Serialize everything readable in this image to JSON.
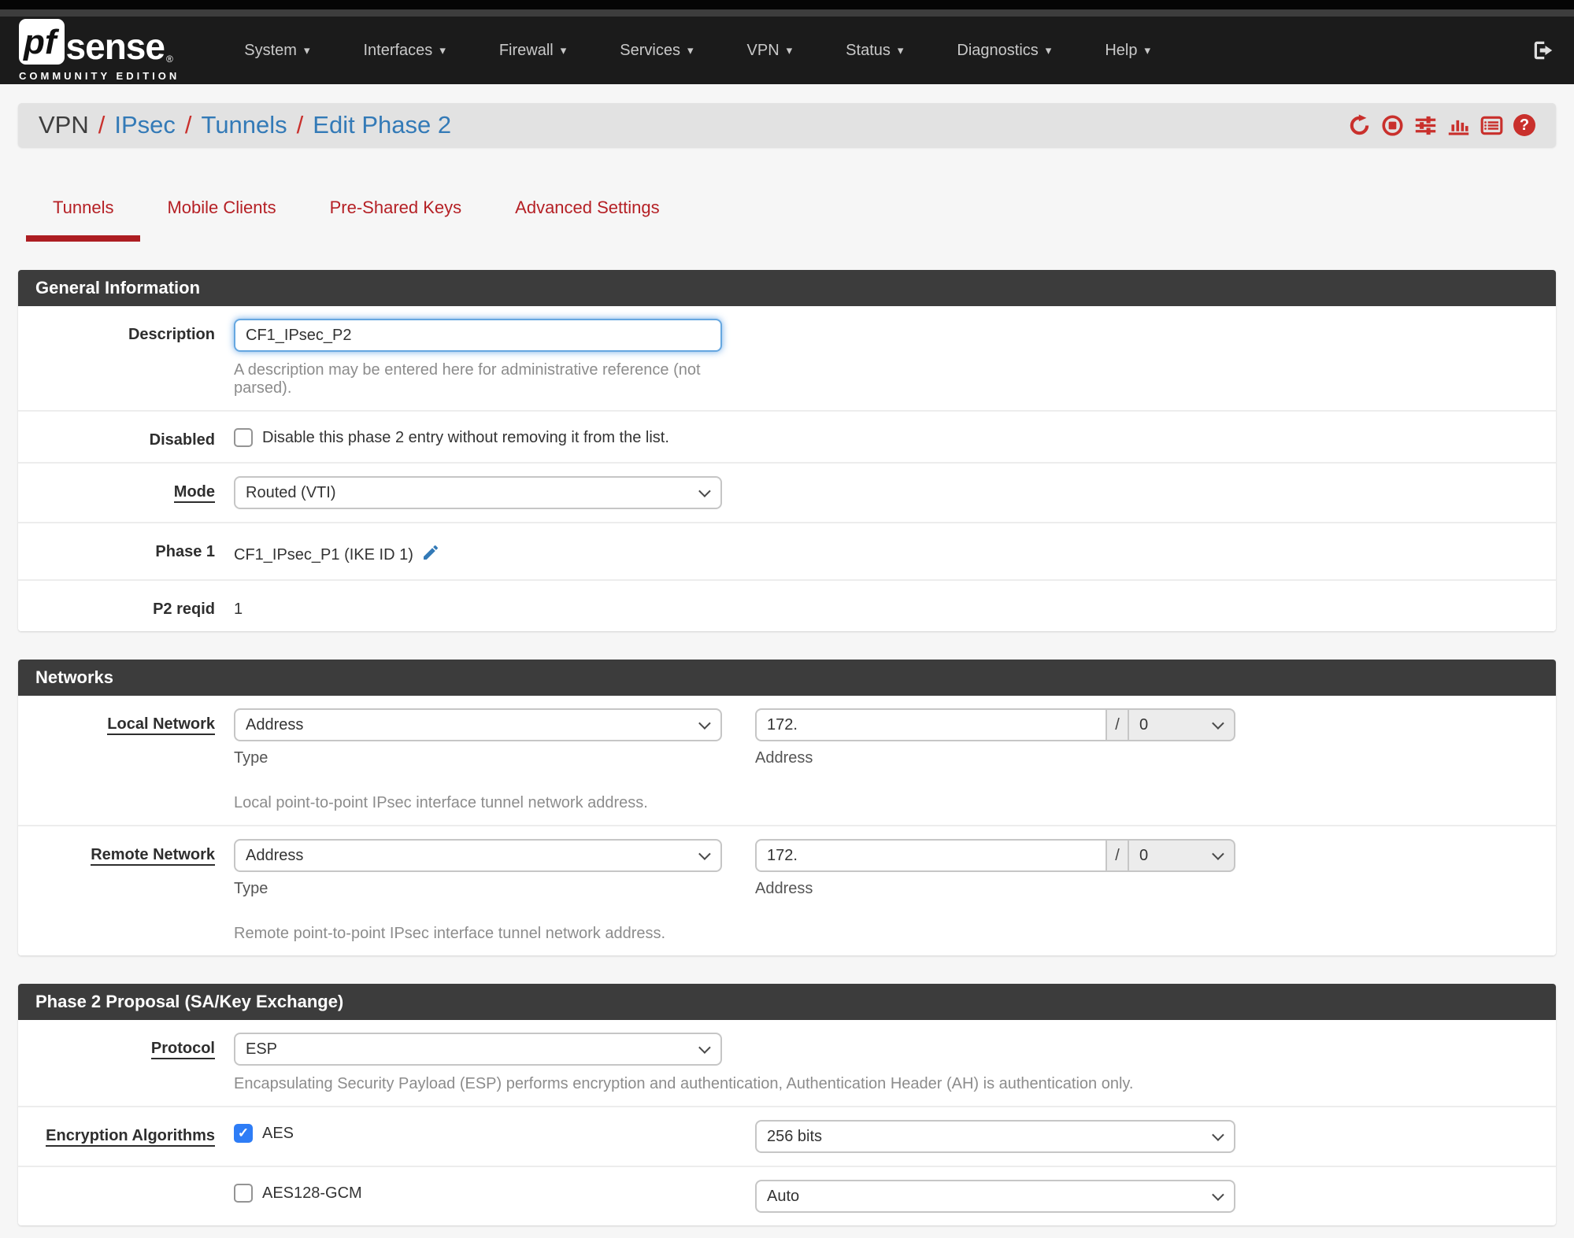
{
  "colors": {
    "navbar_bg": "#1b1b1b",
    "accent_red": "#b52025",
    "icon_red": "#c9302c",
    "link_blue": "#337ab7",
    "checkbox_blue": "#2e7df6",
    "panel_header_bg": "#3c3c3c"
  },
  "navbar": {
    "brand": {
      "pf": "pf",
      "sense": "sense",
      "registered": "®",
      "edition": "COMMUNITY EDITION"
    },
    "items": [
      {
        "label": "System"
      },
      {
        "label": "Interfaces"
      },
      {
        "label": "Firewall"
      },
      {
        "label": "Services"
      },
      {
        "label": "VPN"
      },
      {
        "label": "Status"
      },
      {
        "label": "Diagnostics"
      },
      {
        "label": "Help"
      }
    ],
    "logout_icon": "sign-out-icon"
  },
  "breadcrumb": {
    "separator": "/",
    "items": [
      {
        "label": "VPN"
      },
      {
        "label": "IPsec"
      },
      {
        "label": "Tunnels"
      },
      {
        "label": "Edit Phase 2"
      }
    ],
    "icons": [
      "refresh-icon",
      "stop-circle-icon",
      "sliders-icon",
      "bar-chart-icon",
      "list-icon",
      "help-icon"
    ],
    "help_glyph": "?"
  },
  "tabs": [
    {
      "label": "Tunnels",
      "active": true
    },
    {
      "label": "Mobile Clients",
      "active": false
    },
    {
      "label": "Pre-Shared Keys",
      "active": false
    },
    {
      "label": "Advanced Settings",
      "active": false
    }
  ],
  "general": {
    "title": "General Information",
    "description": {
      "label": "Description",
      "value": "CF1_IPsec_P2",
      "help": "A description may be entered here for administrative reference (not parsed)."
    },
    "disabled": {
      "label": "Disabled",
      "checkbox_label": "Disable this phase 2 entry without removing it from the list.",
      "checked": false
    },
    "mode": {
      "label": "Mode",
      "value": "Routed (VTI)"
    },
    "phase1": {
      "label": "Phase 1",
      "value": "CF1_IPsec_P1 (IKE ID 1)"
    },
    "p2reqid": {
      "label": "P2 reqid",
      "value": "1"
    }
  },
  "networks": {
    "title": "Networks",
    "local": {
      "label": "Local Network",
      "type_value": "Address",
      "type_caption": "Type",
      "address_value": "172.",
      "address_caption": "Address",
      "separator": "/",
      "prefix_value": "0",
      "help": "Local point-to-point IPsec interface tunnel network address."
    },
    "remote": {
      "label": "Remote Network",
      "type_value": "Address",
      "type_caption": "Type",
      "address_value": "172.",
      "address_caption": "Address",
      "separator": "/",
      "prefix_value": "0",
      "help": "Remote point-to-point IPsec interface tunnel network address."
    }
  },
  "proposal": {
    "title": "Phase 2 Proposal (SA/Key Exchange)",
    "protocol": {
      "label": "Protocol",
      "value": "ESP",
      "help": "Encapsulating Security Payload (ESP) performs encryption and authentication, Authentication Header (AH) is authentication only."
    },
    "encryption": {
      "label": "Encryption Algorithms",
      "rows": [
        {
          "name": "AES",
          "checked": true,
          "keylen": "256 bits"
        },
        {
          "name": "AES128-GCM",
          "checked": false,
          "keylen": "Auto"
        }
      ]
    }
  }
}
